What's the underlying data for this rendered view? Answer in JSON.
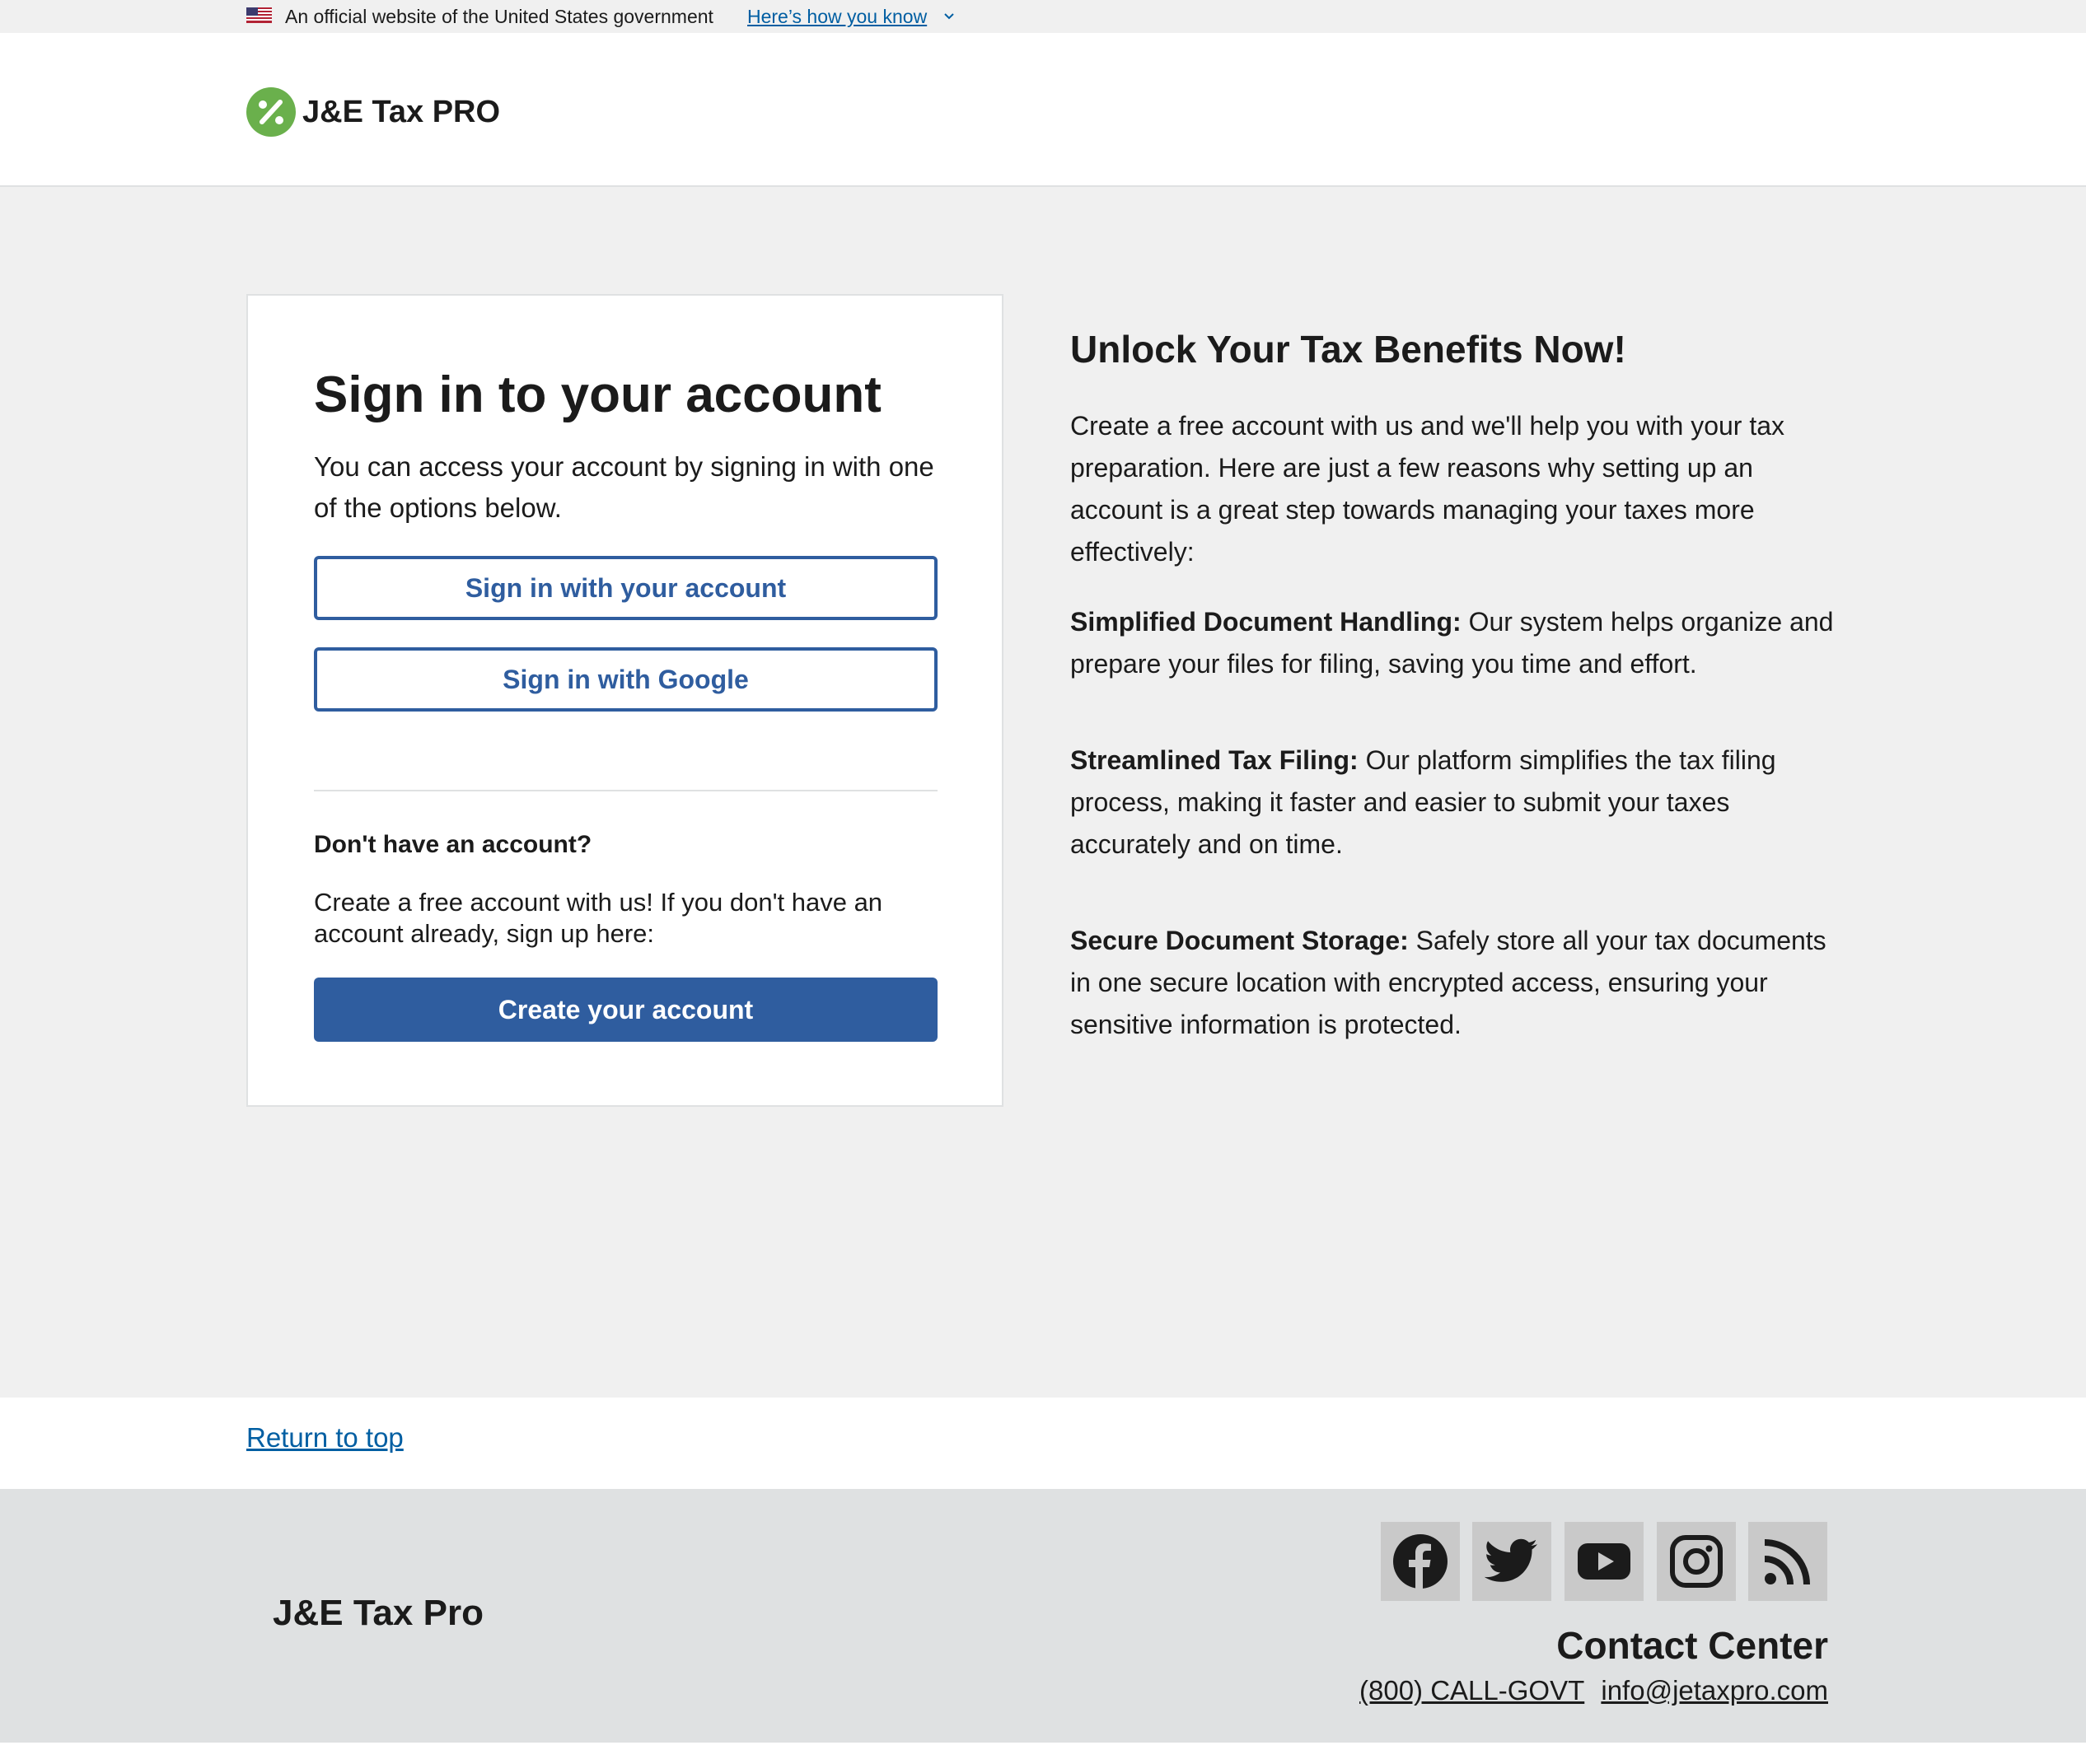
{
  "banner": {
    "official_text": "An official website of the United States government",
    "how_you_know": "Here’s how you know"
  },
  "header": {
    "logo_text": "J&E Tax PRO"
  },
  "signin": {
    "title": "Sign in to your account",
    "intro": "You can access your account by signing in with one of the options below.",
    "account_button": "Sign in with your account",
    "google_button": "Sign in with Google",
    "no_account_heading": "Don't have an account?",
    "signup_text": "Create a free account with us! If you don't have an account already, sign up here:",
    "create_button": "Create your account"
  },
  "benefits": {
    "title": "Unlock Your Tax Benefits Now!",
    "lead": "Create a free account with us and we'll help you with your tax preparation. Here are just a few reasons why setting up an account is a great step towards managing your taxes more effectively:",
    "items": [
      {
        "title": "Simplified Document Handling:",
        "text": " Our system helps organize and prepare your files for filing, saving you time and effort."
      },
      {
        "title": "Streamlined Tax Filing:",
        "text": " Our platform simplifies the tax filing process, making it faster and easier to submit your taxes accurately and on time."
      },
      {
        "title": "Secure Document Storage:",
        "text": " Safely store all your tax documents in one secure location with encrypted access, ensuring your sensitive information is protected."
      }
    ]
  },
  "return_to_top": "Return to top",
  "footer": {
    "name": "J&E Tax Pro",
    "social": [
      "facebook-icon",
      "twitter-icon",
      "youtube-icon",
      "instagram-icon",
      "rss-icon"
    ],
    "contact_heading": "Contact Center",
    "phone": "(800) CALL-GOVT",
    "email": "info@jetaxpro.com"
  },
  "colors": {
    "primary": "#2f5d9f",
    "link": "#005ea2",
    "logo_green": "#6ab04c",
    "main_background": "#f0f0f0",
    "footer_background": "#dfe1e2"
  }
}
